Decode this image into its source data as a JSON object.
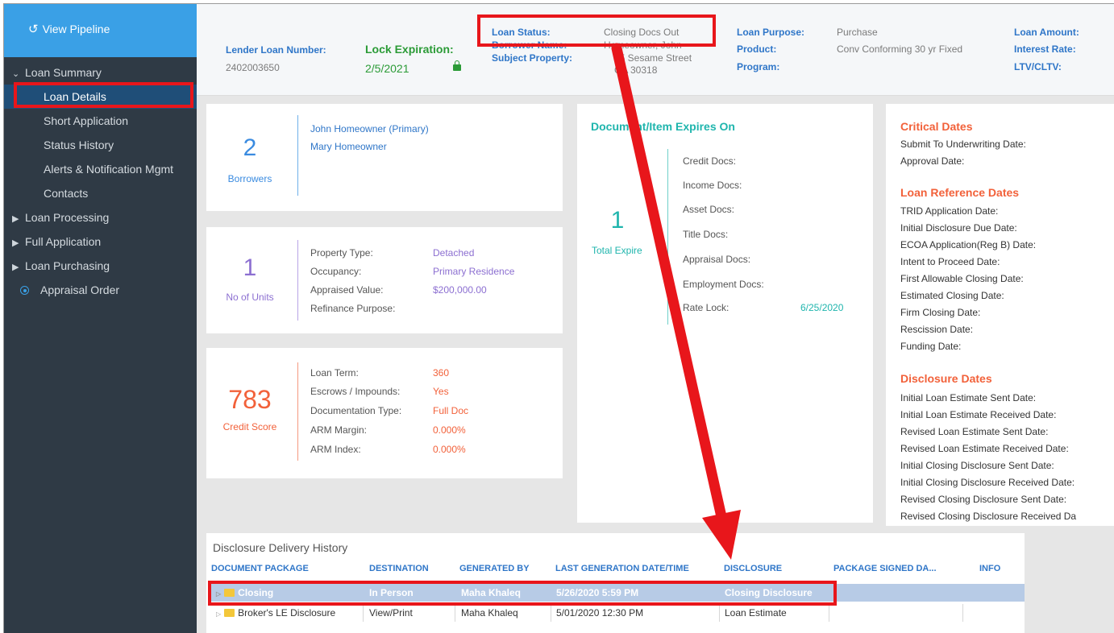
{
  "sidebar": {
    "pipeline_label": "View Pipeline",
    "items": [
      {
        "label": "Loan Summary"
      },
      {
        "label": "Loan Details"
      },
      {
        "label": "Short Application"
      },
      {
        "label": "Status History"
      },
      {
        "label": "Alerts & Notification Mgmt"
      },
      {
        "label": "Contacts"
      },
      {
        "label": "Loan Processing"
      },
      {
        "label": "Full Application"
      },
      {
        "label": "Loan Purchasing"
      },
      {
        "label": "Appraisal Order"
      }
    ]
  },
  "header": {
    "lender_loan_number_label": "Lender Loan Number:",
    "lender_loan_number": "2402003650",
    "lock_expiration_label": "Lock Expiration:",
    "lock_expiration": "2/5/2021",
    "loan_status_label": "Loan Status:",
    "loan_status": "Closing Docs Out",
    "borrower_name_label": "Borrower Name:",
    "borrower_name": "Homeowner, John",
    "subject_property_label": "Subject Property:",
    "subject_property_line1": "35 Sesame Street",
    "subject_property_line2": "GA 30318",
    "loan_purpose_label": "Loan Purpose:",
    "loan_purpose": "Purchase",
    "product_label": "Product:",
    "product": "Conv Conforming 30 yr Fixed",
    "program_label": "Program:",
    "loan_amount_label": "Loan Amount:",
    "interest_rate_label": "Interest Rate:",
    "ltv_label": "LTV/CLTV:"
  },
  "borrowers_card": {
    "count": "2",
    "label": "Borrowers",
    "names": [
      "John Homeowner (Primary)",
      "Mary Homeowner"
    ]
  },
  "units_card": {
    "count": "1",
    "label": "No of Units",
    "rows": [
      {
        "label": "Property Type:",
        "value": "Detached"
      },
      {
        "label": "Occupancy:",
        "value": "Primary Residence"
      },
      {
        "label": "Appraised Value:",
        "value": "$200,000.00"
      },
      {
        "label": "Refinance Purpose:",
        "value": ""
      }
    ]
  },
  "credit_card": {
    "score": "783",
    "label": "Credit Score",
    "rows": [
      {
        "label": "Loan Term:",
        "value": "360"
      },
      {
        "label": "Escrows / Impounds:",
        "value": "Yes"
      },
      {
        "label": "Documentation Type:",
        "value": "Full Doc"
      },
      {
        "label": "ARM Margin:",
        "value": "0.000%"
      },
      {
        "label": "ARM Index:",
        "value": "0.000%"
      }
    ]
  },
  "expires_card": {
    "title": "Document/Item Expires On",
    "count": "1",
    "label": "Total Expire",
    "rows": [
      {
        "label": "Credit Docs:",
        "value": ""
      },
      {
        "label": "Income Docs:",
        "value": ""
      },
      {
        "label": "Asset Docs:",
        "value": ""
      },
      {
        "label": "Title Docs:",
        "value": ""
      },
      {
        "label": "Appraisal Docs:",
        "value": ""
      },
      {
        "label": "Employment Docs:",
        "value": ""
      },
      {
        "label": "Rate Lock:",
        "value": "6/25/2020"
      }
    ]
  },
  "dates_card": {
    "critical_title": "Critical Dates",
    "critical": [
      "Submit To Underwriting Date:",
      "Approval Date:"
    ],
    "reference_title": "Loan Reference Dates",
    "reference": [
      "TRID Application Date:",
      "Initial Disclosure Due Date:",
      "ECOA Application(Reg B) Date:",
      "Intent to Proceed Date:",
      "First Allowable Closing Date:",
      "Estimated Closing Date:",
      "Firm Closing Date:",
      "Rescission Date:",
      "Funding Date:"
    ],
    "disclosure_title": "Disclosure Dates",
    "disclosure": [
      "Initial Loan Estimate Sent Date:",
      "Initial Loan Estimate Received Date:",
      "Revised Loan Estimate Sent Date:",
      "Revised Loan Estimate Received Date:",
      "Initial Closing Disclosure Sent Date:",
      "Initial Closing Disclosure Received Date:",
      "Revised Closing Disclosure Sent Date:",
      "Revised Closing Disclosure Received Da"
    ]
  },
  "history": {
    "title": "Disclosure Delivery History",
    "columns": [
      "DOCUMENT PACKAGE",
      "DESTINATION",
      "GENERATED BY",
      "LAST GENERATION DATE/TIME",
      "DISCLOSURE",
      "PACKAGE SIGNED DA...",
      "INFO"
    ],
    "rows": [
      {
        "package": "Closing",
        "destination": "In Person",
        "generated_by": "Maha Khaleq",
        "date": "5/26/2020 5:59 PM",
        "disclosure": "Closing Disclosure"
      },
      {
        "package": "Broker's LE Disclosure",
        "destination": "View/Print",
        "generated_by": "Maha Khaleq",
        "date": "5/01/2020 12:30 PM",
        "disclosure": "Loan Estimate"
      }
    ]
  },
  "colors": {
    "accent_blue": "#3aa0e6",
    "label_blue": "#2f76c8",
    "green": "#2b9b37",
    "orange_red": "#f2613a",
    "purple": "#8c6fd1",
    "teal": "#1fb5ad",
    "annotation_red": "#e8161b"
  }
}
